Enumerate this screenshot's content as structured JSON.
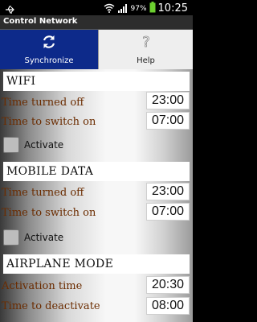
{
  "status_bar": {
    "battery_percent": "97%",
    "time": "10:25",
    "icons": [
      "usb-icon",
      "wifi-icon",
      "signal-icon",
      "battery-icon"
    ]
  },
  "app": {
    "title": "Control Network"
  },
  "tabs": [
    {
      "label": "Synchronize",
      "icon": "sync-icon",
      "active": true
    },
    {
      "label": "Help",
      "icon": "help-icon",
      "active": false
    }
  ],
  "wifi": {
    "header": "WIFI",
    "off_label": "Time turned off",
    "off_time": "23:00",
    "on_label": "Time to switch on",
    "on_time": "07:00",
    "activate_label": "Activate",
    "activate_checked": false
  },
  "mobile_data": {
    "header": "MOBILE DATA",
    "off_label": "Time turned off",
    "off_time": "23:00",
    "on_label": "Time to switch on",
    "on_time": "07:00",
    "activate_label": "Activate",
    "activate_checked": false
  },
  "airplane": {
    "header": "AIRPLANE MODE",
    "activation_label": "Activation time",
    "activation_time": "20:30",
    "deactivate_label": "Time to deactivate",
    "deactivate_time": "08:00"
  },
  "colors": {
    "tab_active": "#0d2a8a",
    "label_text": "#6b2c00"
  }
}
